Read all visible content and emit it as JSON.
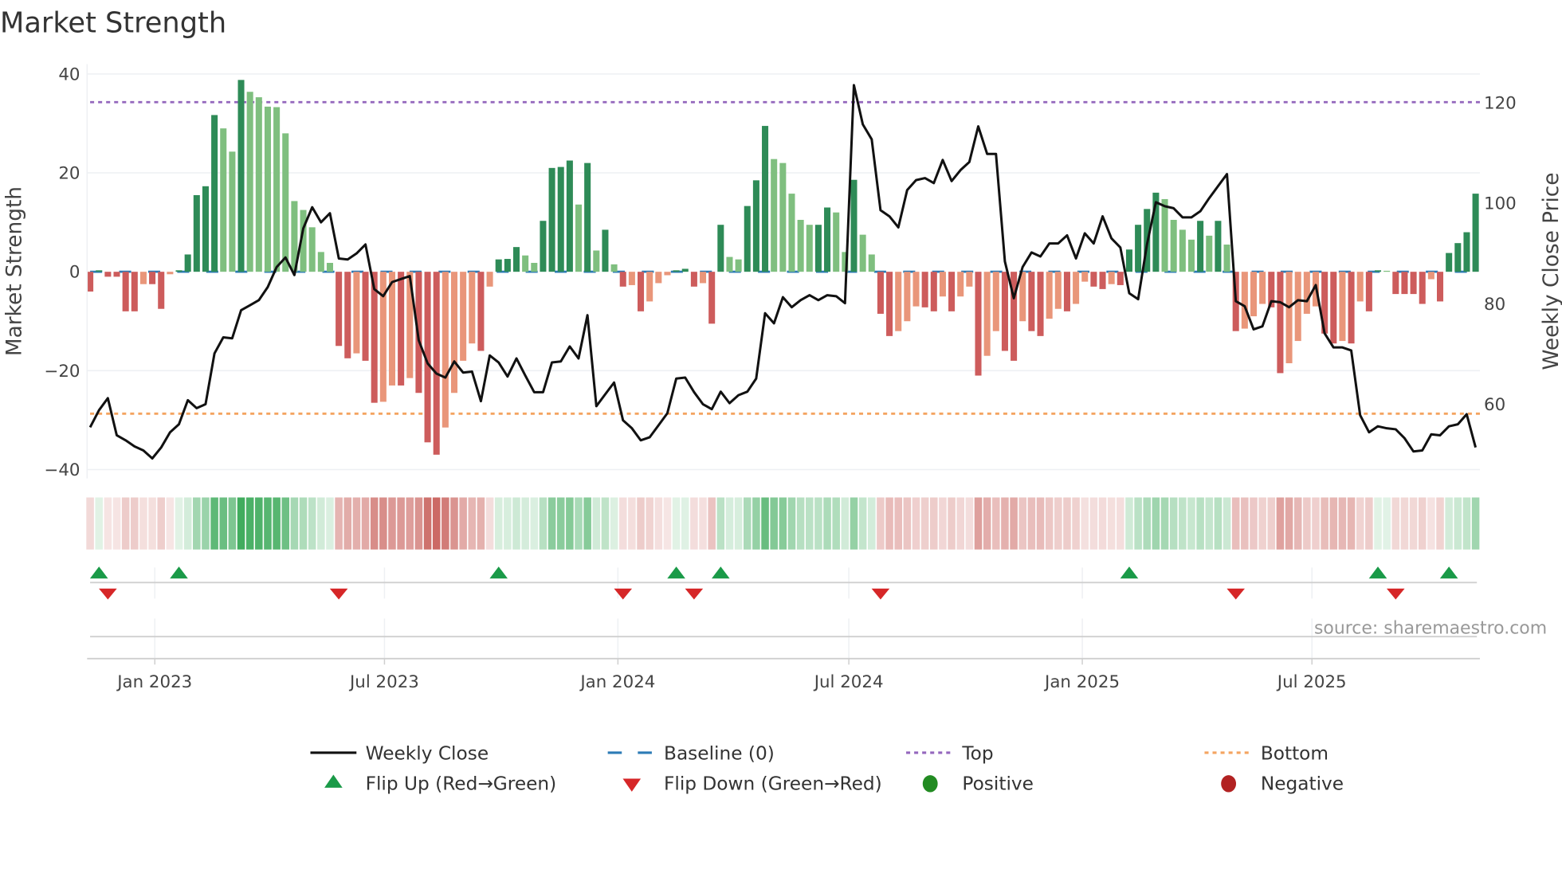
{
  "chart_data": {
    "type": "bar+line",
    "title": "Market Strength",
    "ylabel_left": "Market Strength",
    "ylabel_right": "Weekly Close Price",
    "ylim_left": [
      -42,
      42
    ],
    "ylim_right": [
      47,
      125.7
    ],
    "yticks_left": [
      "40",
      "20",
      "0",
      "−20",
      "−40"
    ],
    "yticks_left_values": [
      40,
      20,
      0,
      -20,
      -40
    ],
    "yticks_right": [
      "120",
      "100",
      "80",
      "60"
    ],
    "yticks_right_values": [
      120,
      100,
      80,
      60
    ],
    "xticks": [
      "Jan 2023",
      "Jul 2023",
      "Jan 2024",
      "Jul 2024",
      "Jan 2025",
      "Jul 2025"
    ],
    "xtick_dates": [
      "2023-01-01",
      "2023-07-01",
      "2024-01-01",
      "2024-07-01",
      "2025-01-01",
      "2025-07-01"
    ],
    "start_date": "2022-11-11",
    "interval": "weekly",
    "top_level": 34.3,
    "bottom_level": -28.7,
    "baseline": 0,
    "strength": [
      -4,
      0.3,
      -1,
      -1,
      -8,
      -8,
      -2.5,
      -2.5,
      -7.5,
      -0.5,
      0.3,
      3.5,
      15.5,
      17.3,
      31.7,
      29,
      24.3,
      38.8,
      36.4,
      35.3,
      33.4,
      33.3,
      28,
      14.3,
      12.5,
      9,
      4,
      1.8,
      -15,
      -17.5,
      -16.5,
      -18,
      -26.5,
      -26.3,
      -23,
      -23,
      -21.5,
      -24.5,
      -34.5,
      -37,
      -31.5,
      -24.5,
      -18,
      -14.5,
      -16,
      -3,
      2.5,
      2.6,
      5,
      3.3,
      1.8,
      10.3,
      21,
      21.2,
      22.5,
      13.6,
      22,
      4.3,
      8.5,
      1.5,
      -3,
      -2.7,
      -8,
      -6,
      -2.3,
      -0.7,
      0.3,
      0.6,
      -3,
      -2.3,
      -10.5,
      9.5,
      3,
      2.5,
      13.3,
      18.5,
      29.5,
      22.8,
      22,
      15.8,
      10.5,
      9.5,
      9.5,
      13,
      12,
      4,
      18.6,
      7.5,
      3.5,
      -8.5,
      -13,
      -12,
      -10,
      -7,
      -7.2,
      -8,
      -5,
      -8,
      -5,
      -3,
      -21,
      -17,
      -12,
      -16,
      -18,
      -10,
      -12,
      -13,
      -9.5,
      -7.5,
      -8,
      -6.5,
      -2,
      -3,
      -3.5,
      -2.5,
      -2.7,
      4.5,
      9.5,
      12.7,
      16,
      14.7,
      10.5,
      8.5,
      6.5,
      10.3,
      7.3,
      10.3,
      5.5,
      -12,
      -11.5,
      -9,
      -6.5,
      -7.2,
      -20.5,
      -18.5,
      -14,
      -8.5,
      -7,
      -12.5,
      -14.5,
      -14,
      -14.5,
      -6,
      -8,
      0.3,
      0.2,
      -4.5,
      -4.5,
      -4.5,
      -6.5,
      -1.5,
      -6,
      3.8,
      5.8,
      8,
      15.8
    ],
    "close": [
      55.4,
      58.8,
      61.2,
      53.8,
      52.8,
      51.6,
      50.8,
      49.2,
      51.4,
      54.4,
      56,
      60.8,
      59.2,
      60,
      70.1,
      73.3,
      73.1,
      78.7,
      79.7,
      80.7,
      83.3,
      87.3,
      89.2,
      85.7,
      95,
      99.2,
      96.2,
      98,
      89,
      88.8,
      90,
      91.8,
      82.9,
      81.5,
      84.3,
      84.9,
      85.5,
      72.7,
      68.1,
      66.1,
      65.3,
      68.5,
      66.3,
      66.5,
      60.6,
      69.7,
      68.3,
      65.5,
      69.1,
      65.7,
      62.4,
      62.4,
      68.3,
      68.5,
      71.5,
      69.1,
      77.7,
      59.6,
      62,
      64.3,
      56.8,
      55.2,
      52.8,
      53.4,
      55.8,
      58.2,
      65.1,
      65.3,
      62.4,
      60,
      59,
      62.5,
      60.2,
      61.8,
      62.5,
      65.1,
      78.1,
      76.1,
      81.3,
      79.3,
      80.7,
      81.7,
      80.7,
      81.7,
      81.5,
      80.1,
      123.5,
      115.7,
      112.7,
      98.6,
      97.4,
      95.2,
      102.6,
      104.6,
      105,
      104,
      108.6,
      104.4,
      106.6,
      108.2,
      115.3,
      109.8,
      109.8,
      88.4,
      81.1,
      87.3,
      90.2,
      89.4,
      92,
      92,
      93.6,
      89,
      94,
      92,
      97.4,
      93,
      91.2,
      82.1,
      80.9,
      91.8,
      100.2,
      99.4,
      99,
      97.2,
      97.2,
      98.4,
      101,
      103.4,
      105.8,
      80.5,
      79.5,
      74.9,
      75.5,
      80.5,
      80.3,
      79.3,
      80.7,
      80.5,
      83.7,
      74.1,
      71.3,
      71.3,
      70.7,
      57.8,
      54.4,
      55.6,
      55.2,
      55,
      53.2,
      50.6,
      50.8,
      54,
      53.8,
      55.6,
      56,
      58,
      51.4
    ],
    "flip_up_dates": [
      "2022-11-18",
      "2023-01-20",
      "2023-09-29",
      "2024-02-16",
      "2024-03-22",
      "2025-02-07",
      "2025-08-22",
      "2025-10-17"
    ],
    "flip_down_dates": [
      "2022-11-25",
      "2023-05-26",
      "2024-01-05",
      "2024-03-01",
      "2024-07-26",
      "2025-05-02",
      "2025-09-05"
    ],
    "legend": {
      "placement": "bottom",
      "weekly_close": "Weekly Close",
      "baseline": "Baseline (0)",
      "top": "Top",
      "bottom": "Bottom",
      "flip_up": "Flip Up (Red→Green)",
      "flip_down": "Flip Down (Green→Red)",
      "positive": "Positive",
      "negative": "Negative"
    },
    "colors": {
      "pos_rising": "#2e8b57",
      "pos_falling": "#7fbf7f",
      "neg_falling": "#cd5c5c",
      "neg_rising": "#e9967a",
      "close_line": "#111111",
      "baseline": "#2c7bb6",
      "top": "#9467bd",
      "bottom": "#f4a460",
      "flip_up": "#1a9a48",
      "flip_down": "#d62728",
      "positive": "#228b22",
      "negative": "#b22222"
    }
  },
  "source": "source: sharemaestro.com"
}
